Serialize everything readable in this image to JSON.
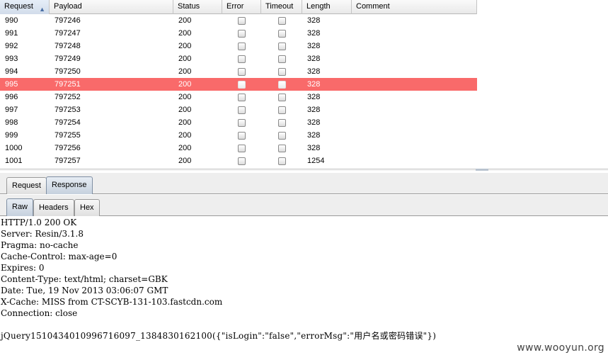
{
  "table": {
    "columns": [
      {
        "key": "request",
        "label": "Request"
      },
      {
        "key": "payload",
        "label": "Payload"
      },
      {
        "key": "status",
        "label": "Status"
      },
      {
        "key": "error",
        "label": "Error"
      },
      {
        "key": "timeout",
        "label": "Timeout"
      },
      {
        "key": "length",
        "label": "Length"
      },
      {
        "key": "comment",
        "label": "Comment"
      }
    ],
    "sort_indicator": "▲",
    "selected_row_color": "#f96a6a",
    "rows": [
      {
        "request": "990",
        "payload": "797246",
        "status": "200",
        "length": "328",
        "comment": "",
        "selected": false
      },
      {
        "request": "991",
        "payload": "797247",
        "status": "200",
        "length": "328",
        "comment": "",
        "selected": false
      },
      {
        "request": "992",
        "payload": "797248",
        "status": "200",
        "length": "328",
        "comment": "",
        "selected": false
      },
      {
        "request": "993",
        "payload": "797249",
        "status": "200",
        "length": "328",
        "comment": "",
        "selected": false
      },
      {
        "request": "994",
        "payload": "797250",
        "status": "200",
        "length": "328",
        "comment": "",
        "selected": false
      },
      {
        "request": "995",
        "payload": "797251",
        "status": "200",
        "length": "328",
        "comment": "",
        "selected": true
      },
      {
        "request": "996",
        "payload": "797252",
        "status": "200",
        "length": "328",
        "comment": "",
        "selected": false
      },
      {
        "request": "997",
        "payload": "797253",
        "status": "200",
        "length": "328",
        "comment": "",
        "selected": false
      },
      {
        "request": "998",
        "payload": "797254",
        "status": "200",
        "length": "328",
        "comment": "",
        "selected": false
      },
      {
        "request": "999",
        "payload": "797255",
        "status": "200",
        "length": "328",
        "comment": "",
        "selected": false
      },
      {
        "request": "1000",
        "payload": "797256",
        "status": "200",
        "length": "328",
        "comment": "",
        "selected": false
      },
      {
        "request": "1001",
        "payload": "797257",
        "status": "200",
        "length": "1254",
        "comment": "",
        "selected": false
      }
    ]
  },
  "tabs": {
    "main": [
      {
        "label": "Request",
        "active": false
      },
      {
        "label": "Response",
        "active": true
      }
    ],
    "sub": [
      {
        "label": "Raw",
        "active": true
      },
      {
        "label": "Headers",
        "active": false
      },
      {
        "label": "Hex",
        "active": false
      }
    ]
  },
  "response": {
    "headers": [
      "HTTP/1.0 200 OK",
      "Server: Resin/3.1.8",
      "Pragma: no-cache",
      "Cache-Control: max-age=0",
      "Expires: 0",
      "Content-Type: text/html; charset=GBK",
      "Date: Tue, 19 Nov 2013 03:06:07 GMT",
      "X-Cache: MISS from CT-SCYB-131-103.fastcdn.com",
      "Connection: close"
    ],
    "body": "jQuery1510434010996716097_1384830162100({\"isLogin\":\"false\",\"errorMsg\":\"用户名或密码错误\"})"
  },
  "watermark": "www.wooyun.org"
}
